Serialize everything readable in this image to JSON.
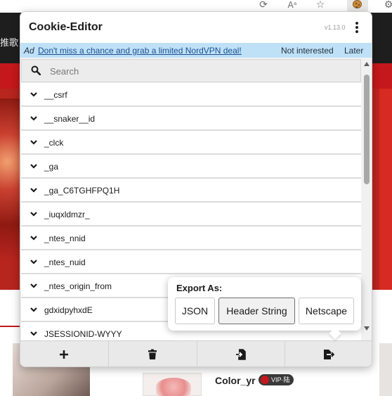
{
  "background": {
    "header_text": "推歌",
    "site_title": "Color_yr",
    "vip_badge": "VIP·陆"
  },
  "popup": {
    "title": "Cookie-Editor",
    "version": "v1.13.0",
    "ad": {
      "label": "Ad",
      "link_text": "Don't miss a chance and grab a limited NordVPN deal!",
      "not_interested": "Not interested",
      "later": "Later"
    },
    "search": {
      "placeholder": "Search",
      "value": ""
    },
    "cookies": [
      "__csrf",
      "__snaker__id",
      "_clck",
      "_ga",
      "_ga_C6TGHFPQ1H",
      "_iuqxldmzr_",
      "_ntes_nnid",
      "_ntes_nuid",
      "_ntes_origin_from",
      "gdxidpyhxdE",
      "JSESSIONID-WYYY"
    ],
    "bottom_bar": [
      "add-icon",
      "trash-icon",
      "import-icon",
      "export-icon"
    ],
    "export": {
      "title": "Export As:",
      "options": [
        "JSON",
        "Header String",
        "Netscape"
      ],
      "selected": "Header String"
    }
  },
  "colors": {
    "ad_background": "#bfe1f8",
    "ad_link": "#1c4f8f",
    "site_red": "#c4181c"
  }
}
